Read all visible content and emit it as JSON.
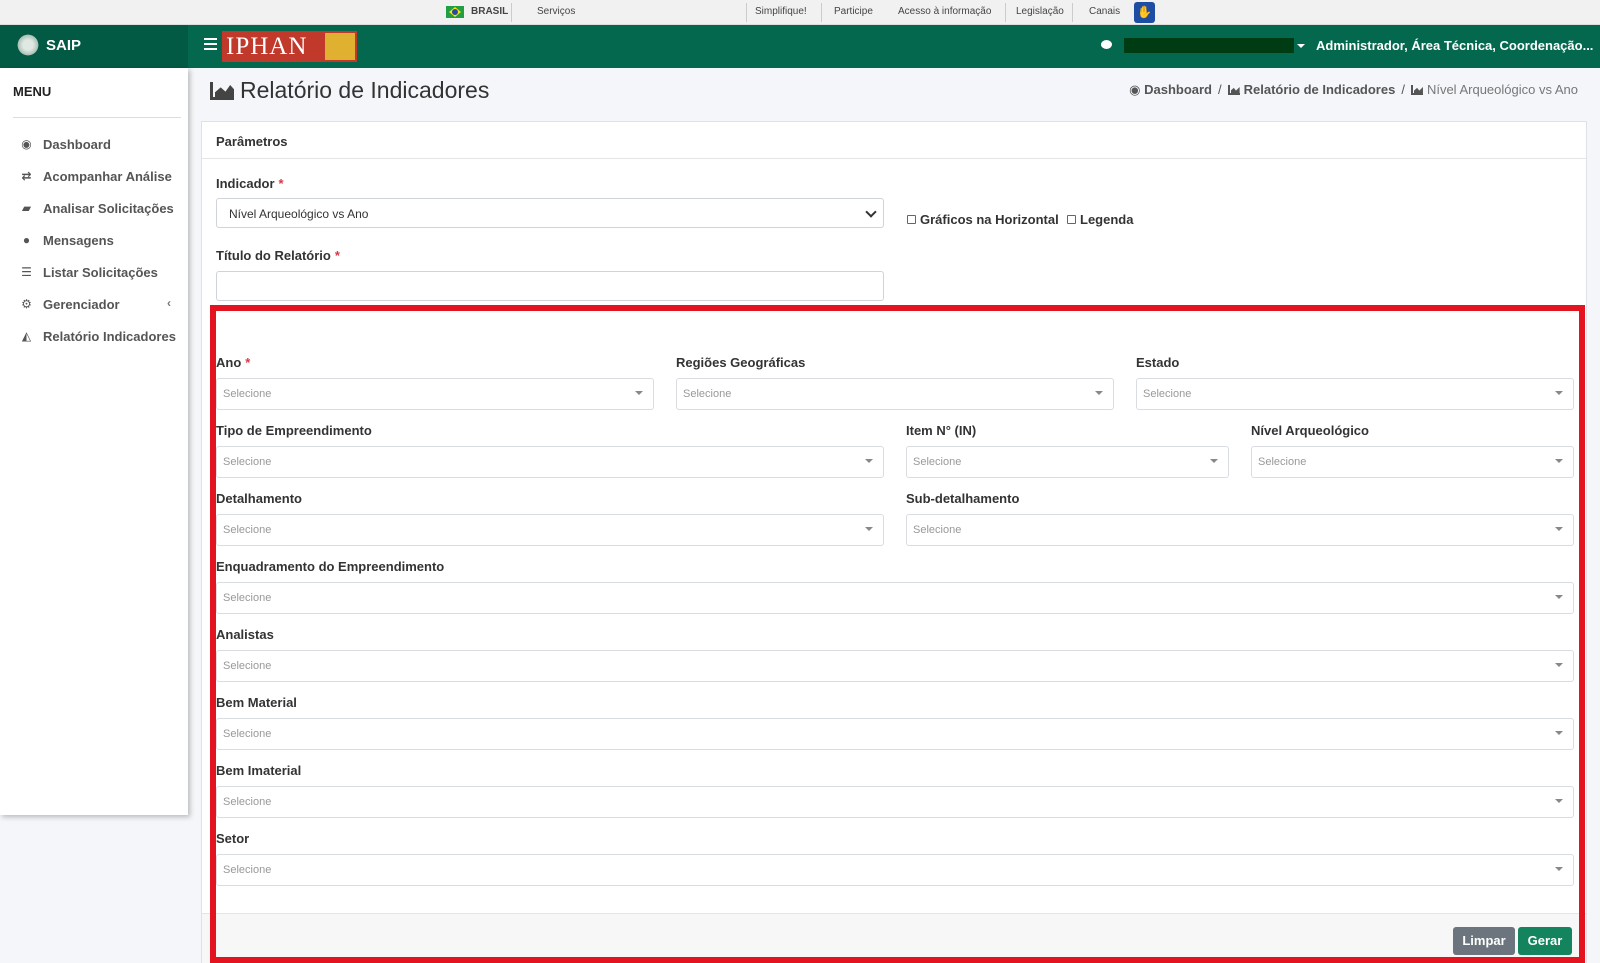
{
  "govbar": {
    "brasil": "BRASIL",
    "servicos": "Serviços",
    "links": [
      "Simplifique!",
      "Participe",
      "Acesso à informação",
      "Legislação",
      "Canais"
    ]
  },
  "navbar": {
    "app_name": "SAIP",
    "logo_text": "IPHAN",
    "user_role": "Administrador, Área Técnica, Coordenação..."
  },
  "sidebar": {
    "title": "MENU",
    "items": [
      {
        "label": "Dashboard",
        "icon": "dashboard-icon"
      },
      {
        "label": "Acompanhar Análise",
        "icon": "exchange-icon"
      },
      {
        "label": "Analisar Solicitações",
        "icon": "book-icon"
      },
      {
        "label": "Mensagens",
        "icon": "comments-icon"
      },
      {
        "label": "Listar Solicitações",
        "icon": "list-icon"
      },
      {
        "label": "Gerenciador",
        "icon": "cogs-icon"
      },
      {
        "label": "Relatório Indicadores",
        "icon": "area-chart-icon"
      }
    ]
  },
  "header": {
    "title": "Relatório de Indicadores",
    "breadcrumb": [
      "Dashboard",
      "Relatório de Indicadores",
      "Nível Arqueológico vs Ano"
    ]
  },
  "form": {
    "section_title": "Parâmetros",
    "indicador_label": "Indicador",
    "indicador_value": "Nível Arqueológico vs Ano",
    "horizontal_label": "Gráficos na Horizontal",
    "legenda_label": "Legenda",
    "titulo_label": "Título do Relatório",
    "titulo_value": "",
    "placeholder": "Selecione",
    "fields": {
      "ano": "Ano",
      "regioes": "Regiões Geográficas",
      "estado": "Estado",
      "tipo": "Tipo de Empreendimento",
      "item": "Item N° (IN)",
      "nivel": "Nível Arqueológico",
      "detalhamento": "Detalhamento",
      "subdetalhamento": "Sub-detalhamento",
      "enquadramento": "Enquadramento do Empreendimento",
      "analistas": "Analistas",
      "bem_material": "Bem Material",
      "bem_imaterial": "Bem Imaterial",
      "setor": "Setor"
    },
    "buttons": {
      "limpar": "Limpar",
      "gerar": "Gerar"
    }
  },
  "colors": {
    "brand": "#04684f",
    "highlight": "#e3141f",
    "primary_button": "#14845f"
  }
}
